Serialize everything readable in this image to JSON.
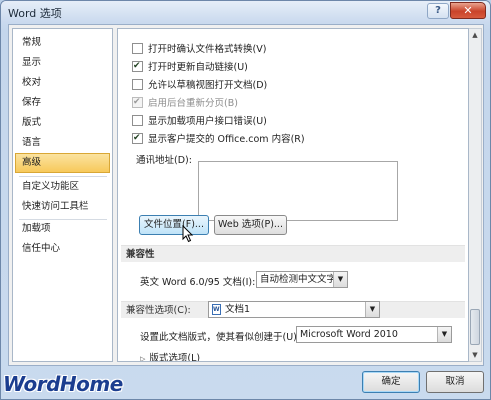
{
  "window": {
    "title": "Word 选项",
    "help_label": "?",
    "close_label": "✕"
  },
  "sidebar": {
    "items": [
      {
        "label": "常规"
      },
      {
        "label": "显示"
      },
      {
        "label": "校对"
      },
      {
        "label": "保存"
      },
      {
        "label": "版式"
      },
      {
        "label": "语言"
      },
      {
        "label": "高级",
        "selected": true
      },
      {
        "label": "自定义功能区"
      },
      {
        "label": "快速访问工具栏"
      },
      {
        "label": "加载项"
      },
      {
        "label": "信任中心"
      }
    ]
  },
  "options": [
    {
      "label": "打开时确认文件格式转换(V)",
      "checked": false,
      "disabled": false
    },
    {
      "label": "打开时更新自动链接(U)",
      "checked": true,
      "disabled": false
    },
    {
      "label": "允许以草稿视图打开文档(D)",
      "checked": false,
      "disabled": false
    },
    {
      "label": "启用后台重新分页(B)",
      "checked": true,
      "disabled": true
    },
    {
      "label": "显示加载项用户接口错误(U)",
      "checked": false,
      "disabled": false
    },
    {
      "label": "显示客户提交的 Office.com 内容(R)",
      "checked": true,
      "disabled": false
    }
  ],
  "mailing_address": {
    "label": "通讯地址(D):",
    "value": ""
  },
  "buttons": {
    "file_locations": "文件位置(F)...",
    "web_options": "Web 选项(P)..."
  },
  "compat_section": {
    "title": "兼容性",
    "word6_label": "英文 Word 6.0/95 文档(I):",
    "word6_value": "自动检测中文文字",
    "compat_options_label": "兼容性选项(C):",
    "compat_options_value": "文档1",
    "layout_label": "设置此文档版式，使其看似创建于(U):",
    "layout_value": "Microsoft Word 2010",
    "layout_options_label": "版式选项(L)"
  },
  "footer": {
    "ok": "确定",
    "cancel": "取消"
  },
  "watermark": "WordHome"
}
